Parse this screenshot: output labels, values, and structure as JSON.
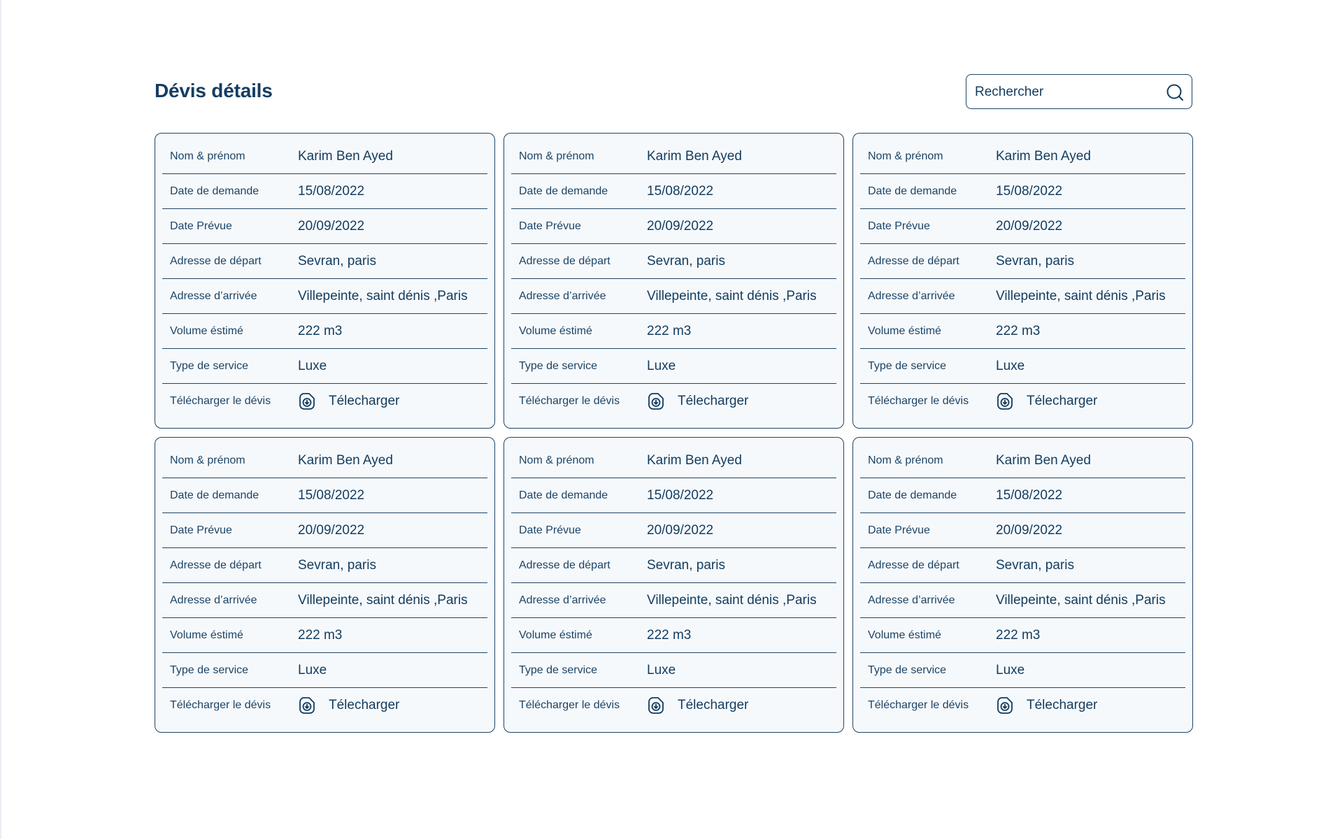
{
  "header": {
    "title": "Dévis détails",
    "search_placeholder": "Rechercher"
  },
  "labels": {
    "name": "Nom & prénom",
    "request_date": "Date de demande",
    "planned_date": "Date Prévue",
    "departure_address": "Adresse de départ",
    "arrival_address": "Adresse d’arrivée",
    "volume": "Volume éstimé",
    "service_type": "Type de service",
    "download": "Télécharger le dévis"
  },
  "download_link_label": "Télecharger",
  "cards": [
    {
      "name": "Karim Ben Ayed",
      "request_date": "15/08/2022",
      "planned_date": "20/09/2022",
      "departure_address": "Sevran, paris",
      "arrival_address": "Villepeinte, saint dénis ,Paris",
      "volume": "222 m3",
      "service_type": "Luxe"
    },
    {
      "name": "Karim Ben Ayed",
      "request_date": "15/08/2022",
      "planned_date": "20/09/2022",
      "departure_address": "Sevran, paris",
      "arrival_address": "Villepeinte, saint dénis ,Paris",
      "volume": "222 m3",
      "service_type": "Luxe"
    },
    {
      "name": "Karim Ben Ayed",
      "request_date": "15/08/2022",
      "planned_date": "20/09/2022",
      "departure_address": "Sevran, paris",
      "arrival_address": "Villepeinte, saint dénis ,Paris",
      "volume": "222 m3",
      "service_type": "Luxe"
    },
    {
      "name": "Karim Ben Ayed",
      "request_date": "15/08/2022",
      "planned_date": "20/09/2022",
      "departure_address": "Sevran, paris",
      "arrival_address": "Villepeinte, saint dénis ,Paris",
      "volume": "222 m3",
      "service_type": "Luxe"
    },
    {
      "name": "Karim Ben Ayed",
      "request_date": "15/08/2022",
      "planned_date": "20/09/2022",
      "departure_address": "Sevran, paris",
      "arrival_address": "Villepeinte, saint dénis ,Paris",
      "volume": "222 m3",
      "service_type": "Luxe"
    },
    {
      "name": "Karim Ben Ayed",
      "request_date": "15/08/2022",
      "planned_date": "20/09/2022",
      "departure_address": "Sevran, paris",
      "arrival_address": "Villepeinte, saint dénis ,Paris",
      "volume": "222 m3",
      "service_type": "Luxe"
    }
  ],
  "icons": {
    "search": "search-icon",
    "download": "download-file-icon"
  },
  "colors": {
    "primary": "#143d63",
    "border": "#1f4566",
    "card_background": "#f6f9fc"
  }
}
